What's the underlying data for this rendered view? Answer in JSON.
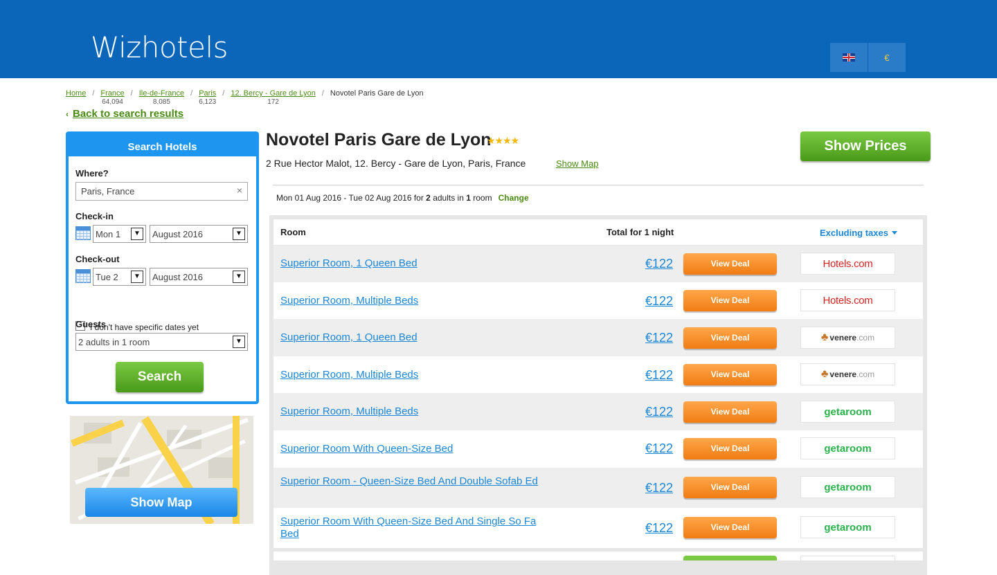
{
  "header": {
    "logo": "Wizhotels",
    "currency": "€",
    "language_icon": "uk-flag-icon"
  },
  "breadcrumb": {
    "items": [
      {
        "label": "Home",
        "count": ""
      },
      {
        "label": "France",
        "count": "64,094"
      },
      {
        "label": "Ile-de-France",
        "count": "8,085"
      },
      {
        "label": "Paris",
        "count": "6,123"
      },
      {
        "label": "12. Bercy - Gare de Lyon",
        "count": "172"
      }
    ],
    "current": "Novotel Paris Gare de Lyon",
    "separator": "/"
  },
  "back_link": "Back to search results",
  "search_panel": {
    "title": "Search Hotels",
    "where_label": "Where?",
    "where_value": "Paris, France",
    "checkin_label": "Check-in",
    "checkin_day": "Mon 1",
    "checkin_month": "August 2016",
    "checkout_label": "Check-out",
    "checkout_day": "Tue 2",
    "checkout_month": "August 2016",
    "no_dates_label": "I don't have specific dates yet",
    "guests_label": "Guests",
    "guests_value": "2 adults in 1 room",
    "search_button": "Search"
  },
  "map": {
    "button": "Show Map"
  },
  "hotel": {
    "name": "Novotel Paris Gare de Lyon",
    "stars": "★★★★",
    "star_rating": 4,
    "address": "2 Rue Hector Malot, 12. Bercy - Gare de Lyon, Paris, France",
    "show_map": "Show Map",
    "show_prices": "Show Prices"
  },
  "dates_summary": {
    "text_before": "Mon 01 Aug 2016 - Tue 02 Aug 2016 for ",
    "adults": "2",
    "text_mid": " adults in ",
    "rooms": "1",
    "text_after": " room",
    "change": "Change"
  },
  "table": {
    "col_room": "Room",
    "col_total": "Total for 1 night",
    "col_tax": "Excluding taxes",
    "rows": [
      {
        "room": "Superior Room, 1 Queen Bed",
        "price": "€122",
        "deal": "View Deal",
        "provider": "Hotels.com"
      },
      {
        "room": "Superior Room, Multiple Beds",
        "price": "€122",
        "deal": "View Deal",
        "provider": "Hotels.com"
      },
      {
        "room": "Superior Room, 1 Queen Bed",
        "price": "€122",
        "deal": "View Deal",
        "provider": "venere",
        "provider_suffix": ".com"
      },
      {
        "room": "Superior Room, Multiple Beds",
        "price": "€122",
        "deal": "View Deal",
        "provider": "venere",
        "provider_suffix": ".com"
      },
      {
        "room": "Superior Room, Multiple Beds",
        "price": "€122",
        "deal": "View Deal",
        "provider": "getaroom"
      },
      {
        "room": "Superior Room With Queen-Size Bed",
        "price": "€122",
        "deal": "View Deal",
        "provider": "getaroom"
      },
      {
        "room": "Superior Room - Queen-Size Bed And Double Sofab Ed",
        "price": "€122",
        "deal": "View Deal",
        "provider": "getaroom"
      },
      {
        "room": "Superior Room With Queen-Size Bed And Single So Fa Bed",
        "price": "€122",
        "deal": "View Deal",
        "provider": "getaroom"
      }
    ]
  },
  "colors": {
    "header_bg": "#0b66b9",
    "accent_green": "#4a8a12",
    "link_blue": "#1a86d6",
    "deal_orange": "#f07c14"
  }
}
